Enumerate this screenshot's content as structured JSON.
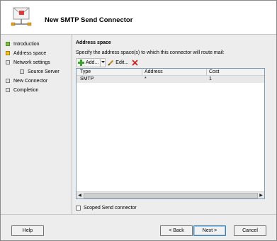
{
  "wizard": {
    "title": "New SMTP Send Connector"
  },
  "sidebar": {
    "items": [
      {
        "label": "Introduction",
        "status": "complete"
      },
      {
        "label": "Address space",
        "status": "current"
      },
      {
        "label": "Network settings",
        "status": "pending"
      },
      {
        "label": "Source Server",
        "status": "pending"
      },
      {
        "label": "New Connector",
        "status": "pending"
      },
      {
        "label": "Completion",
        "status": "pending"
      }
    ]
  },
  "main": {
    "section_title": "Address space",
    "instruction": "Specify the address space(s) to which this connector will route mail:",
    "toolbar": {
      "add_label": "Add...",
      "edit_label": "Edit..."
    },
    "grid": {
      "columns": [
        "Type",
        "Address",
        "Cost"
      ],
      "rows": [
        [
          "SMTP",
          "*",
          "1"
        ]
      ]
    },
    "scoped_label": "Scoped Send connector",
    "scoped_checked": false
  },
  "footer": {
    "help": "Help",
    "back": "< Back",
    "next": "Next >",
    "cancel": "Cancel"
  },
  "colors": {
    "complete": "#7cc242",
    "current": "#f0c419",
    "pending": "#e4e4e4",
    "delete_icon": "#d42020",
    "add_icon": "#3aa52b"
  }
}
